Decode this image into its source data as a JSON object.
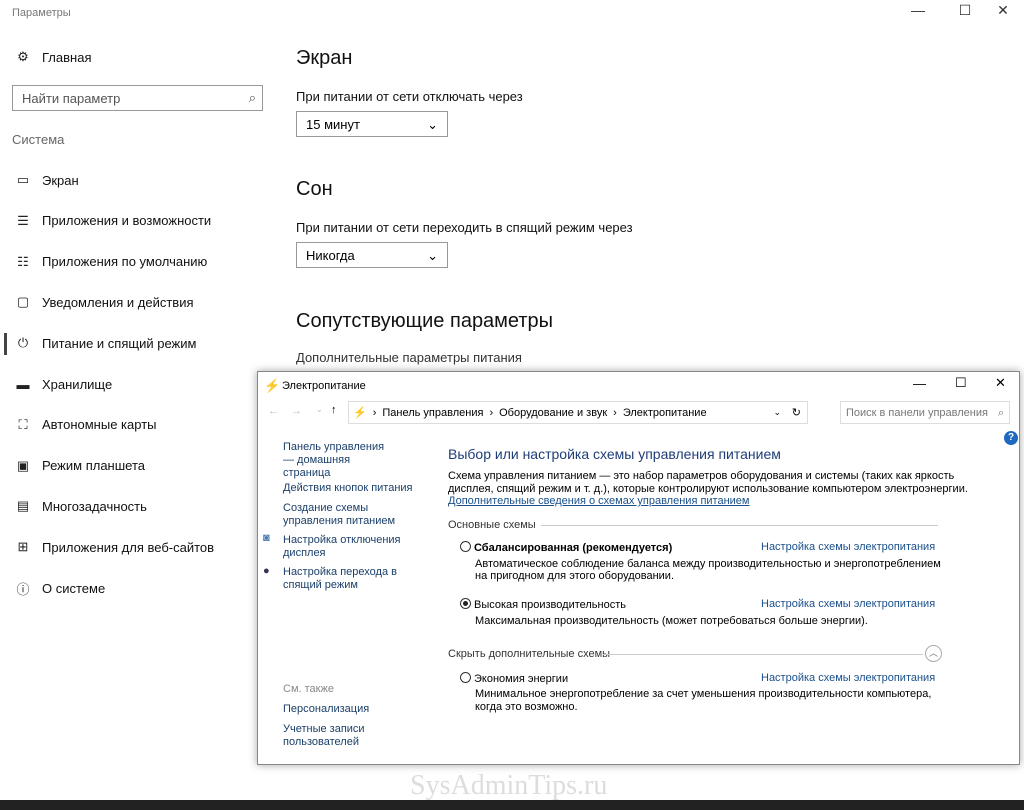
{
  "settings": {
    "title": "Параметры",
    "home": "Главная",
    "search_placeholder": "Найти параметр",
    "section": "Система",
    "nav": [
      {
        "label": "Экран",
        "icon": "monitor-icon"
      },
      {
        "label": "Приложения и возможности",
        "icon": "apps-list-icon"
      },
      {
        "label": "Приложения по умолчанию",
        "icon": "default-apps-icon"
      },
      {
        "label": "Уведомления и действия",
        "icon": "notifications-icon"
      },
      {
        "label": "Питание и спящий режим",
        "icon": "power-icon"
      },
      {
        "label": "Хранилище",
        "icon": "storage-icon"
      },
      {
        "label": "Автономные карты",
        "icon": "map-icon"
      },
      {
        "label": "Режим планшета",
        "icon": "tablet-icon"
      },
      {
        "label": "Многозадачность",
        "icon": "multitask-icon"
      },
      {
        "label": "Приложения для веб-сайтов",
        "icon": "web-apps-icon"
      },
      {
        "label": "О системе",
        "icon": "info-icon"
      }
    ],
    "screen_heading": "Экран",
    "screen_label": "При питании от сети отключать через",
    "screen_value": "15 минут",
    "sleep_heading": "Сон",
    "sleep_label": "При питании от сети переходить в спящий режим через",
    "sleep_value": "Никогда",
    "related_heading": "Сопутствующие параметры",
    "related_link": "Дополнительные параметры питания"
  },
  "power": {
    "title": "Электропитание",
    "breadcrumb": [
      "Панель управления",
      "Оборудование и звук",
      "Электропитание"
    ],
    "search_placeholder": "Поиск в панели управления",
    "side": {
      "home": "Панель управления — домашняя страница",
      "buttons": "Действия кнопок питания",
      "create": "Создание схемы управления питанием",
      "display": "Настройка отключения дисплея",
      "sleep": "Настройка перехода в спящий режим",
      "see_also": "См. также",
      "personalization": "Персонализация",
      "accounts": "Учетные записи пользователей"
    },
    "heading": "Выбор или настройка схемы управления питанием",
    "desc1": "Схема управления питанием — это набор параметров оборудования и системы (таких как яркость",
    "desc2": "дисплея, спящий режим и т. д.), которые контролируют использование компьютером электроэнергии.",
    "more_link": "Дополнительные сведения о схемах управления питанием",
    "main_plans": "Основные схемы",
    "hide_plans": "Скрыть дополнительные схемы",
    "plan_link": "Настройка схемы электропитания",
    "plans": [
      {
        "name": "Сбалансированная (рекомендуется)",
        "d1": "Автоматическое соблюдение баланса между производительностью и энергопотреблением",
        "d2": "на пригодном для этого оборудовании.",
        "selected": false
      },
      {
        "name": "Высокая производительность",
        "d1": "Максимальная производительность (может потребоваться больше энергии).",
        "selected": true
      },
      {
        "name": "Экономия энергии",
        "d1": "Минимальное энергопотребление за счет уменьшения производительности компьютера,",
        "d2": "когда это возможно.",
        "selected": false
      }
    ]
  },
  "watermark": "SysAdminTips.ru"
}
